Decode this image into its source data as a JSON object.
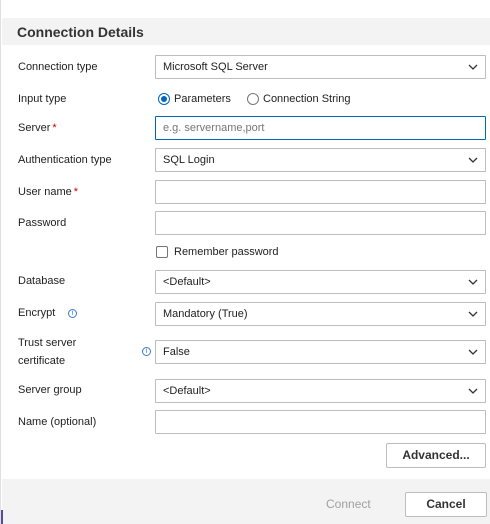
{
  "title": "Connection Details",
  "labels": {
    "connection_type": "Connection type",
    "input_type": "Input type",
    "server": "Server",
    "auth_type": "Authentication type",
    "user_name": "User name",
    "password": "Password",
    "remember_password": "Remember password",
    "database": "Database",
    "encrypt": "Encrypt",
    "trust_server_line1": "Trust server",
    "trust_server_line2": "certificate",
    "server_group": "Server group",
    "name_optional": "Name (optional)"
  },
  "required_marker": "*",
  "fields": {
    "connection_type": "Microsoft SQL Server",
    "input_type_options": [
      "Parameters",
      "Connection String"
    ],
    "input_type_selected": "Parameters",
    "server_placeholder": "e.g. servername,port",
    "auth_type": "SQL Login",
    "user_name": "",
    "password": "",
    "remember_password": false,
    "database": "<Default>",
    "encrypt": "Mandatory (True)",
    "trust_server_certificate": "False",
    "server_group": "<Default>",
    "name_optional": ""
  },
  "icons": {
    "info": "i",
    "chevron": "chevron-down-icon"
  },
  "buttons": {
    "advanced": "Advanced...",
    "connect": "Connect",
    "cancel": "Cancel"
  },
  "colors": {
    "accent": "#0066b8",
    "required": "#cc0000",
    "disabled_text": "#a0a0a0"
  }
}
